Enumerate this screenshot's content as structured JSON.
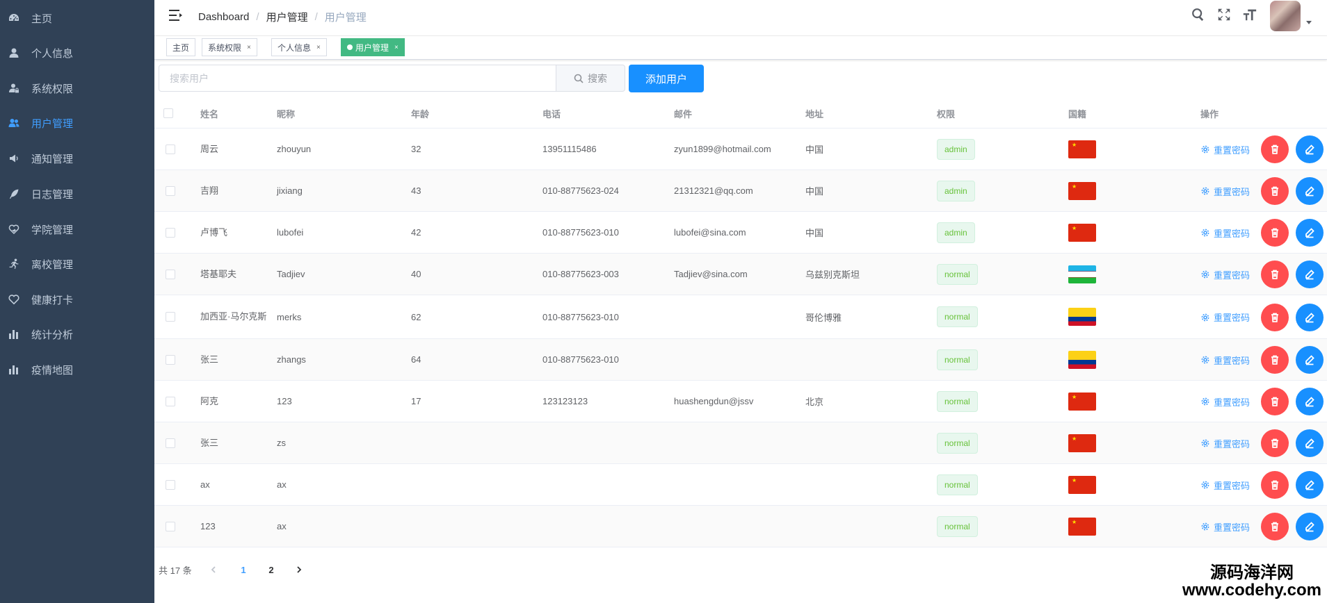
{
  "sidebar": {
    "items": [
      {
        "label": "主页",
        "icon": "dashboard-icon",
        "active": false
      },
      {
        "label": "个人信息",
        "icon": "user-icon",
        "active": false
      },
      {
        "label": "系统权限",
        "icon": "user-lock-icon",
        "active": false
      },
      {
        "label": "用户管理",
        "icon": "users-icon",
        "active": true
      },
      {
        "label": "通知管理",
        "icon": "speaker-icon",
        "active": false
      },
      {
        "label": "日志管理",
        "icon": "feather-icon",
        "active": false
      },
      {
        "label": "学院管理",
        "icon": "heart-hand-icon",
        "active": false
      },
      {
        "label": "离校管理",
        "icon": "running-icon",
        "active": false
      },
      {
        "label": "健康打卡",
        "icon": "heart-icon",
        "active": false
      },
      {
        "label": "统计分析",
        "icon": "bar-chart-icon",
        "active": false
      },
      {
        "label": "疫情地图",
        "icon": "bar-chart-icon",
        "active": false
      }
    ]
  },
  "navbar": {
    "breadcrumb": [
      "Dashboard",
      "用户管理",
      "用户管理"
    ],
    "breadcrumb_sep": "/"
  },
  "tags": [
    {
      "label": "主页",
      "closable": false,
      "active": false
    },
    {
      "label": "系统权限",
      "closable": true,
      "active": false
    },
    {
      "label": "个人信息",
      "closable": true,
      "active": false
    },
    {
      "label": "用户管理",
      "closable": true,
      "active": true
    }
  ],
  "tag_close": "×",
  "toolbar": {
    "search_placeholder": "搜索用户",
    "search_value": "",
    "search_button": "搜索",
    "add_button": "添加用户"
  },
  "table": {
    "columns": [
      "姓名",
      "昵称",
      "年龄",
      "电话",
      "邮件",
      "地址",
      "权限",
      "国籍",
      "操作"
    ],
    "reset_label": "重置密码",
    "rows": [
      {
        "name": "周云",
        "nick": "zhouyun",
        "age": "32",
        "phone": "13951115486",
        "email": "zyun1899@hotmail.com",
        "addr": "中国",
        "role": "admin",
        "flag": "cn"
      },
      {
        "name": "吉翔",
        "nick": "jixiang",
        "age": "43",
        "phone": "010-88775623-024",
        "email": "21312321@qq.com",
        "addr": "中国",
        "role": "admin",
        "flag": "cn"
      },
      {
        "name": "卢博飞",
        "nick": "lubofei",
        "age": "42",
        "phone": "010-88775623-010",
        "email": "lubofei@sina.com",
        "addr": "中国",
        "role": "admin",
        "flag": "cn"
      },
      {
        "name": "塔基耶夫",
        "nick": "Tadjiev",
        "age": "40",
        "phone": "010-88775623-003",
        "email": "Tadjiev@sina.com",
        "addr": "乌兹别克斯坦",
        "role": "normal",
        "flag": "uz"
      },
      {
        "name": "加西亚·马尔克斯",
        "nick": "merks",
        "age": "62",
        "phone": "010-88775623-010",
        "email": "",
        "addr": "哥伦博雅",
        "role": "normal",
        "flag": "co"
      },
      {
        "name": "张三",
        "nick": "zhangs",
        "age": "64",
        "phone": "010-88775623-010",
        "email": "",
        "addr": "",
        "role": "normal",
        "flag": "co"
      },
      {
        "name": "阿克",
        "nick": "123",
        "age": "17",
        "phone": "123123123",
        "email": "huashengdun@jssv",
        "addr": "北京",
        "role": "normal",
        "flag": "cn"
      },
      {
        "name": "张三",
        "nick": "zs",
        "age": "",
        "phone": "",
        "email": "",
        "addr": "",
        "role": "normal",
        "flag": "cn"
      },
      {
        "name": "ax",
        "nick": "ax",
        "age": "",
        "phone": "",
        "email": "",
        "addr": "",
        "role": "normal",
        "flag": "cn"
      },
      {
        "name": "123",
        "nick": "ax",
        "age": "",
        "phone": "",
        "email": "",
        "addr": "",
        "role": "normal",
        "flag": "cn"
      }
    ]
  },
  "pagination": {
    "total_text": "共 17 条",
    "pages": [
      "1",
      "2"
    ],
    "current": "1"
  },
  "watermark": {
    "line1": "源码海洋网",
    "line2": "www.codehy.com"
  },
  "colors": {
    "sidebar_bg": "#304156",
    "accent": "#409eff",
    "primary_button": "#1890ff",
    "danger": "#ff4d4f",
    "active_tag": "#42b983"
  }
}
